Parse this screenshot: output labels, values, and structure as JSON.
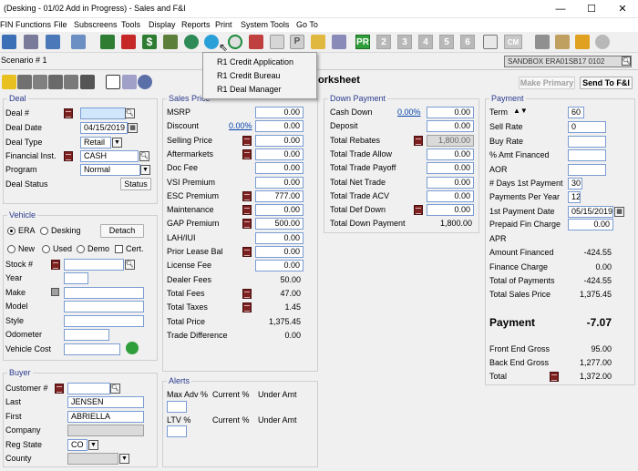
{
  "window": {
    "title": "(Desking - 01/02 Add in Progress) - Sales and F&I",
    "minimize": "—",
    "maximize": "☐",
    "close": "✕"
  },
  "menu": [
    "FIN Functions",
    "File",
    "Subscreens",
    "Tools",
    "Display",
    "Reports",
    "Print",
    "System Tools",
    "Go To"
  ],
  "toolbar": {
    "numbered": [
      "2",
      "3",
      "4",
      "5",
      "6"
    ],
    "pr_label": "PR",
    "cm_label": "CM"
  },
  "scenario": {
    "label": "Scenario # 1",
    "sandbox": "SANDBOX ERA01SB17 0102"
  },
  "worksheet": {
    "title_fragment": "orksheet",
    "make_primary": "Make Primary",
    "send_fi": "Send To F&I"
  },
  "popup_menu": [
    "R1 Credit Application",
    "R1 Credit Bureau",
    "R1 Deal Manager"
  ],
  "deal": {
    "title": "Deal",
    "deal_no_label": "Deal #",
    "deal_no": "",
    "deal_date_label": "Deal Date",
    "deal_date": "04/15/2019",
    "deal_type_label": "Deal Type",
    "deal_type": "Retail",
    "fin_inst_label": "Financial Inst.",
    "fin_inst": "CASH",
    "program_label": "Program",
    "program": "Normal",
    "status_label": "Deal Status",
    "status_button": "Status"
  },
  "vehicle": {
    "title": "Vehicle",
    "era": "ERA",
    "desking": "Desking",
    "detach": "Detach",
    "new": "New",
    "used": "Used",
    "demo": "Demo",
    "cert": "Cert.",
    "stock_label": "Stock #",
    "year_label": "Year",
    "make_label": "Make",
    "model_label": "Model",
    "style_label": "Style",
    "odometer_label": "Odometer",
    "cost_label": "Vehicle Cost"
  },
  "buyer": {
    "title": "Buyer",
    "customer_label": "Customer #",
    "last_label": "Last",
    "last": "JENSEN",
    "first_label": "First",
    "first": "ABRIELLA",
    "company_label": "Company",
    "reg_state_label": "Reg State",
    "reg_state": "CO",
    "county_label": "County"
  },
  "sales_price": {
    "title": "Sales Price",
    "rows": [
      {
        "label": "MSRP",
        "value": "0.00"
      },
      {
        "label": "Discount",
        "link": "0.00%",
        "value": "0.00"
      },
      {
        "label": "Selling Price",
        "value": "0.00"
      },
      {
        "label": "Aftermarkets",
        "value": "0.00"
      },
      {
        "label": "Doc Fee",
        "value": "0.00"
      },
      {
        "label": "VSI Premium",
        "value": "0.00"
      },
      {
        "label": "ESC Premium",
        "value": "777.00"
      },
      {
        "label": "Maintenance",
        "value": "0.00"
      },
      {
        "label": "GAP Premium",
        "value": "500.00"
      },
      {
        "label": "LAH/IUI",
        "value": "0.00"
      },
      {
        "label": "Prior Lease Bal",
        "value": "0.00"
      },
      {
        "label": "License Fee",
        "value": "0.00"
      },
      {
        "label": "Dealer Fees",
        "value": "50.00"
      },
      {
        "label": "Total Fees",
        "value": "47.00"
      },
      {
        "label": "Total Taxes",
        "value": "1.45"
      },
      {
        "label": "Total Price",
        "value": "1,375.45"
      },
      {
        "label": "Trade Difference",
        "value": "0.00"
      }
    ]
  },
  "alerts": {
    "title": "Alerts",
    "max_adv": "Max Adv %",
    "current1": "Current %",
    "under1": "Under Amt",
    "ltv": "LTV %",
    "current2": "Current %",
    "under2": "Under Amt"
  },
  "down_payment": {
    "title": "Down Payment",
    "rows": [
      {
        "label": "Cash Down",
        "link": "0.00%",
        "value": "0.00"
      },
      {
        "label": "Deposit",
        "value": "0.00"
      },
      {
        "label": "Total Rebates",
        "value": "1,800.00"
      },
      {
        "label": "Total Trade Allow",
        "value": "0.00"
      },
      {
        "label": "Total Trade Payoff",
        "value": "0.00"
      },
      {
        "label": "Total Net Trade",
        "value": "0.00"
      },
      {
        "label": "Total Trade ACV",
        "value": "0.00"
      },
      {
        "label": "Total Def Down",
        "value": "0.00"
      },
      {
        "label": "Total Down Payment",
        "value": "1,800.00"
      }
    ]
  },
  "payment": {
    "title": "Payment",
    "term_label": "Term",
    "term": "60",
    "sell_rate_label": "Sell Rate",
    "sell_rate": "0",
    "buy_rate_label": "Buy Rate",
    "amt_financed_label": "% Amt Financed",
    "aor_label": "AOR",
    "days_label": "# Days 1st Payment",
    "days": "30",
    "per_year_label": "Payments Per Year",
    "per_year": "12",
    "first_date_label": "1st Payment Date",
    "first_date": "05/15/2019",
    "prepaid_label": "Prepaid Fin Charge",
    "prepaid": "0.00",
    "apr_label": "APR",
    "amount_financed_label": "Amount Financed",
    "amount_financed": "-424.55",
    "finance_charge_label": "Finance Charge",
    "finance_charge": "0.00",
    "total_payments_label": "Total of Payments",
    "total_payments": "-424.55",
    "total_sales_label": "Total Sales Price",
    "total_sales": "1,375.45",
    "payment_label": "Payment",
    "payment": "-7.07",
    "front_gross_label": "Front End Gross",
    "front_gross": "95.00",
    "back_gross_label": "Back End Gross",
    "back_gross": "1,277.00",
    "total_label": "Total",
    "total": "1,372.00"
  }
}
